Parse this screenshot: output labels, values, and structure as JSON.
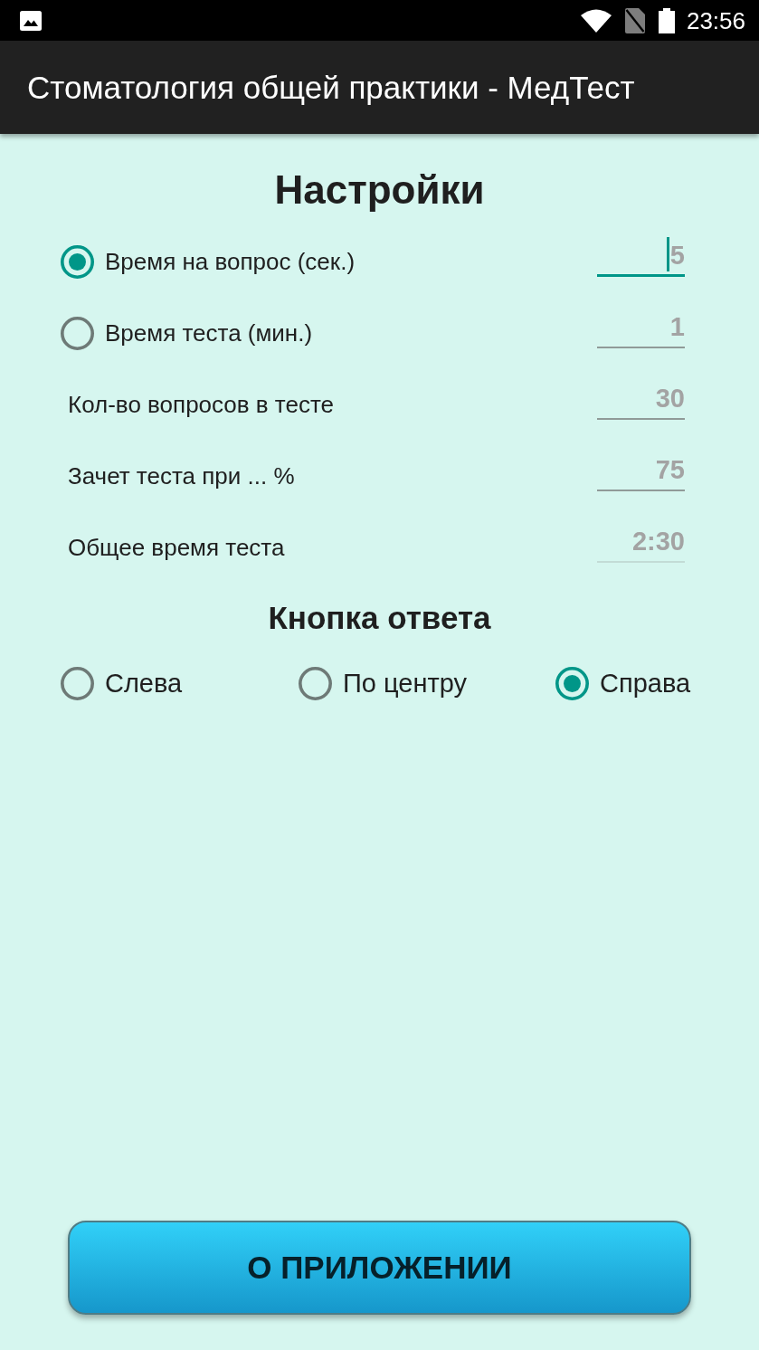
{
  "status_bar": {
    "time": "23:56"
  },
  "app_bar": {
    "title": "Стоматология общей практики - МедТест"
  },
  "settings": {
    "title": "Настройки",
    "rows": [
      {
        "kind": "radio",
        "label": "Время на вопрос (сек.)",
        "selected": true,
        "value": "5",
        "focused": true,
        "disabled": false
      },
      {
        "kind": "radio",
        "label": "Время теста (мин.)",
        "selected": false,
        "value": "1",
        "focused": false,
        "disabled": false
      },
      {
        "kind": "plain",
        "label": "Кол-во вопросов в тесте",
        "value": "30",
        "focused": false,
        "disabled": false
      },
      {
        "kind": "plain",
        "label": "Зачет теста при ... %",
        "value": "75",
        "focused": false,
        "disabled": false
      },
      {
        "kind": "plain",
        "label": "Общее время теста",
        "value": "2:30",
        "focused": false,
        "disabled": true
      }
    ]
  },
  "answer_button": {
    "title": "Кнопка ответа",
    "options": [
      {
        "label": "Слева",
        "selected": false
      },
      {
        "label": "По центру",
        "selected": false
      },
      {
        "label": "Справа",
        "selected": true
      }
    ]
  },
  "about_button": {
    "label": "О ПРИЛОЖЕНИИ"
  }
}
